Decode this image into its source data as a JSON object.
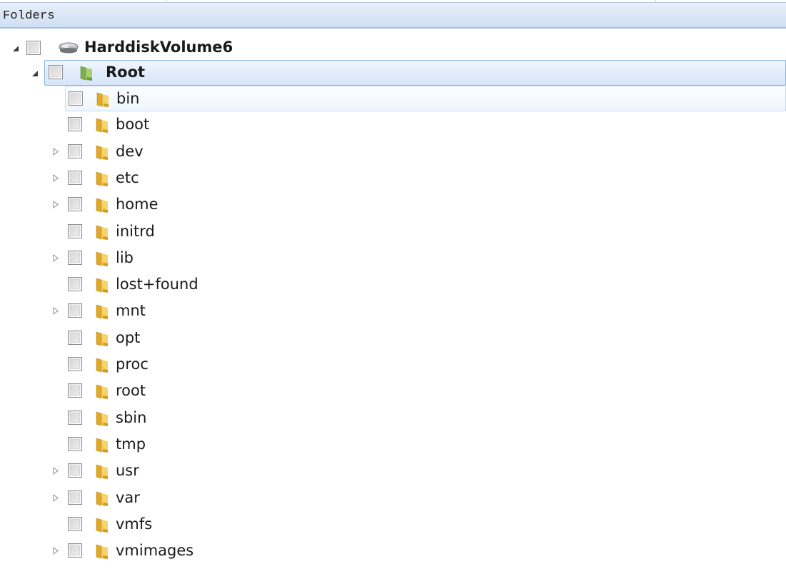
{
  "header": {
    "title": "Folders"
  },
  "tree": {
    "volume": {
      "label": "HarddiskVolume6",
      "expanded": true,
      "checked": false,
      "icon": "hard-drive-icon"
    },
    "root": {
      "label": "Root",
      "expanded": true,
      "checked": false,
      "selected": true,
      "icon": "folder-icon"
    },
    "children": [
      {
        "label": "bin",
        "has_children": false,
        "checked": false
      },
      {
        "label": "boot",
        "has_children": false,
        "checked": false
      },
      {
        "label": "dev",
        "has_children": true,
        "checked": false
      },
      {
        "label": "etc",
        "has_children": true,
        "checked": false
      },
      {
        "label": "home",
        "has_children": true,
        "checked": false
      },
      {
        "label": "initrd",
        "has_children": false,
        "checked": false
      },
      {
        "label": "lib",
        "has_children": true,
        "checked": false
      },
      {
        "label": "lost+found",
        "has_children": false,
        "checked": false
      },
      {
        "label": "mnt",
        "has_children": true,
        "checked": false
      },
      {
        "label": "opt",
        "has_children": false,
        "checked": false
      },
      {
        "label": "proc",
        "has_children": false,
        "checked": false
      },
      {
        "label": "root",
        "has_children": false,
        "checked": false
      },
      {
        "label": "sbin",
        "has_children": false,
        "checked": false
      },
      {
        "label": "tmp",
        "has_children": false,
        "checked": false
      },
      {
        "label": "usr",
        "has_children": true,
        "checked": false
      },
      {
        "label": "var",
        "has_children": true,
        "checked": false
      },
      {
        "label": "vmfs",
        "has_children": false,
        "checked": false
      },
      {
        "label": "vmimages",
        "has_children": true,
        "checked": false
      }
    ]
  },
  "colors": {
    "header_bg": "#dce8f7",
    "selection_border": "#8fb2de",
    "folder_yellow": "#f2c94c",
    "folder_green": "#8fbf5a"
  }
}
